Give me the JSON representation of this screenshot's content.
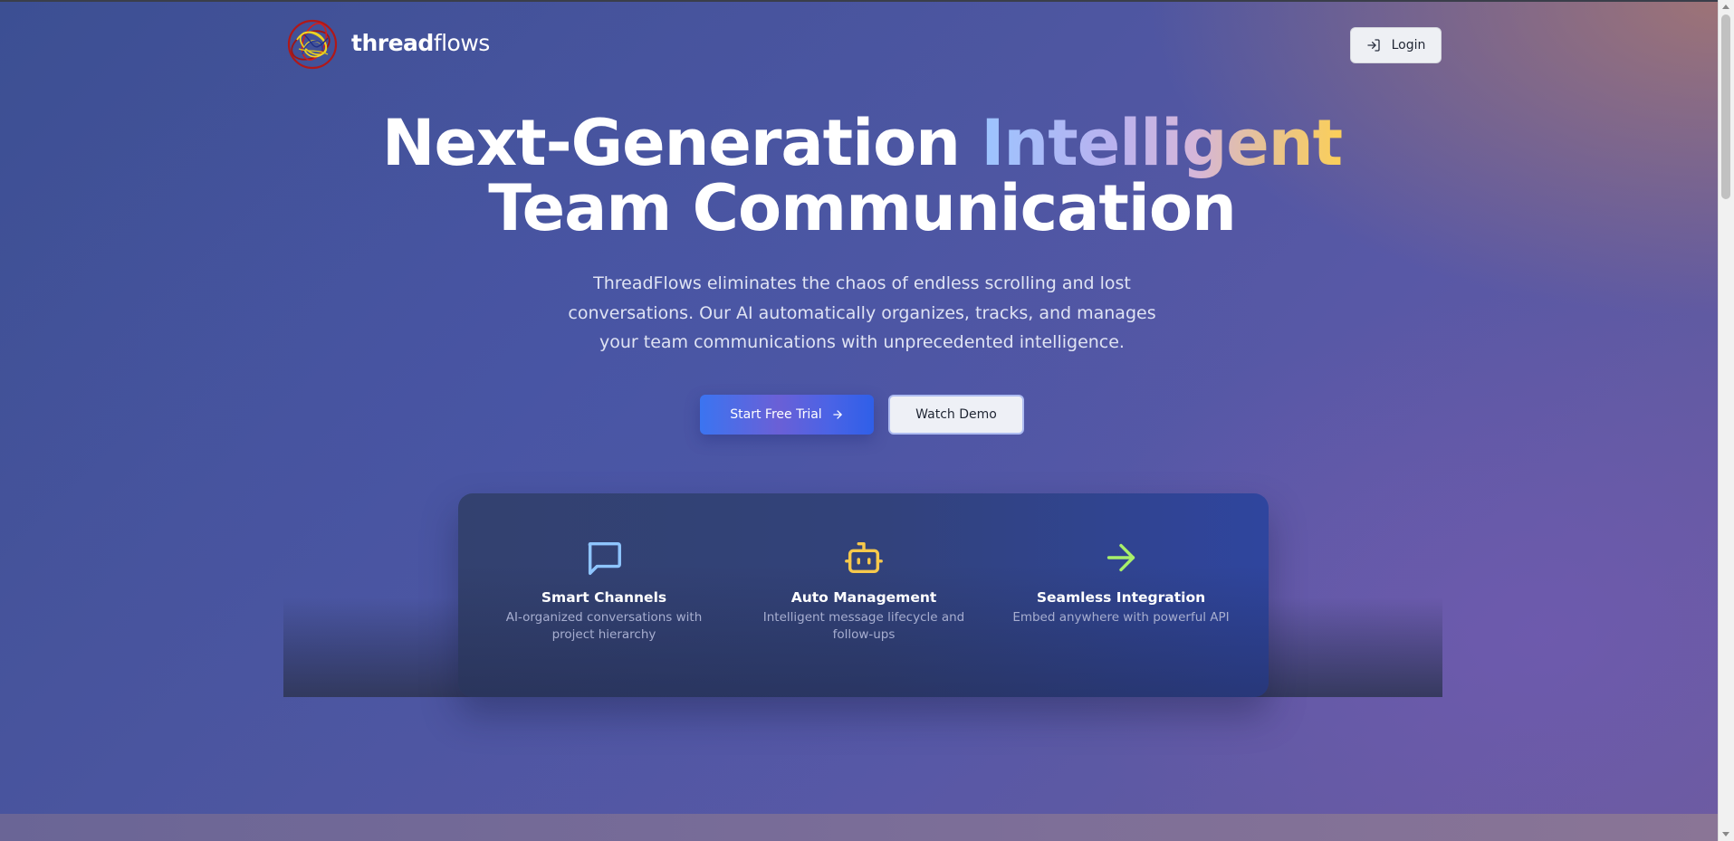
{
  "header": {
    "brand_bold": "thread",
    "brand_light": "flows",
    "login_label": "Login",
    "login_icon": "log-in-icon",
    "logo_icon": "tangled-threads-logo"
  },
  "hero": {
    "title_line1": "Next-Generation ",
    "title_accent": "Intelligent",
    "title_line2": "Team Communication",
    "subtitle": "ThreadFlows eliminates the chaos of endless scrolling and lost conversations. Our AI automatically organizes, tracks, and manages your team communications with unprecedented intelligence.",
    "primary_cta": "Start Free Trial",
    "primary_cta_icon": "arrow-right-icon",
    "secondary_cta": "Watch Demo"
  },
  "features": [
    {
      "icon": "chat-bubble-icon",
      "icon_color": "#8ec5ff",
      "title": "Smart Channels",
      "description": "AI-organized conversations with project hierarchy"
    },
    {
      "icon": "bot-icon",
      "icon_color": "#f7c94b",
      "title": "Auto Management",
      "description": "Intelligent message lifecycle and follow-ups"
    },
    {
      "icon": "arrow-right-icon",
      "icon_color": "#a8f06a",
      "title": "Seamless Integration",
      "description": "Embed anywhere with powerful API"
    }
  ],
  "colors": {
    "accent_gradient": [
      "#9cc4ff",
      "#b8b2f0",
      "#d6b6d8",
      "#e8c38e",
      "#fbcf59"
    ],
    "primary_button": "#3b74f1",
    "panel": "#32427a"
  }
}
